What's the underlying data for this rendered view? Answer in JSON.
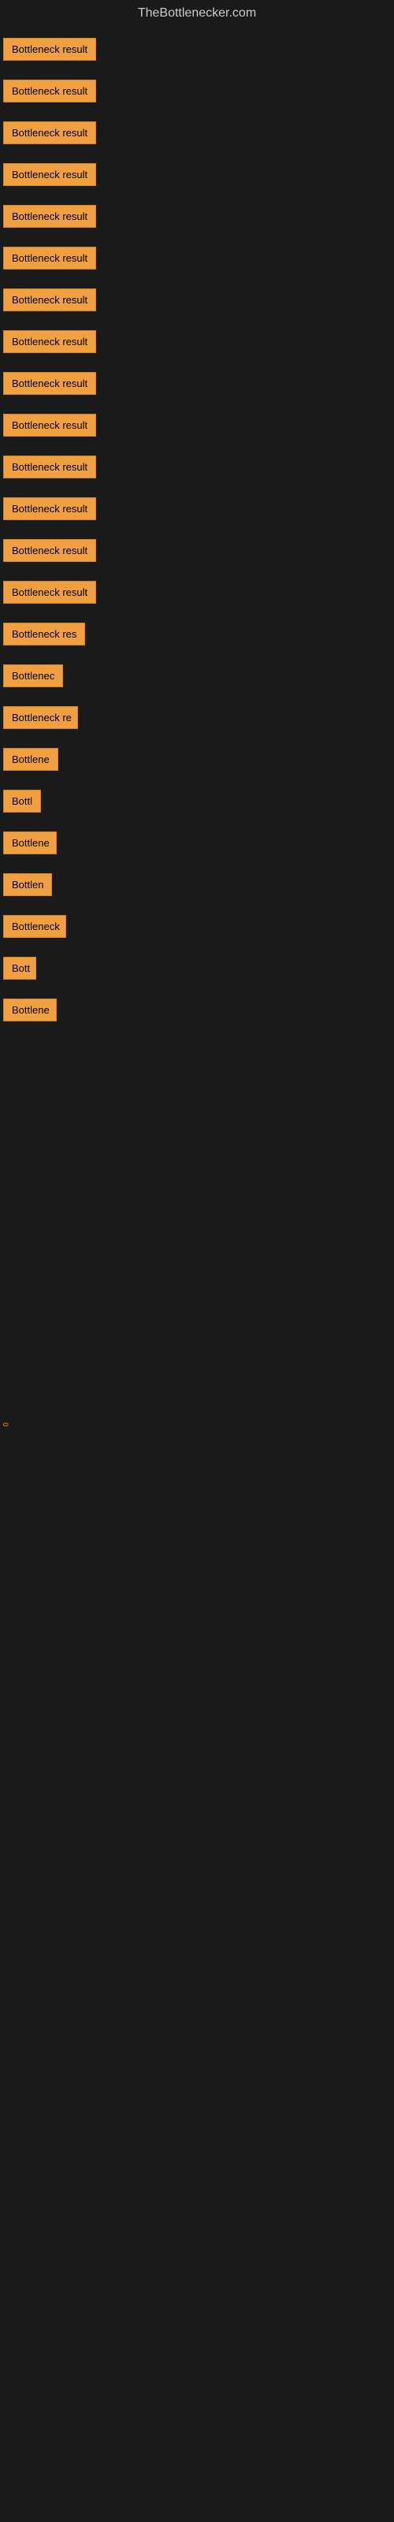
{
  "site": {
    "title": "TheBottlenecker.com"
  },
  "items": [
    {
      "label": "Bottleneck result",
      "width": 130
    },
    {
      "label": "Bottleneck result",
      "width": 130
    },
    {
      "label": "Bottleneck result",
      "width": 130
    },
    {
      "label": "Bottleneck result",
      "width": 130
    },
    {
      "label": "Bottleneck result",
      "width": 130
    },
    {
      "label": "Bottleneck result",
      "width": 130
    },
    {
      "label": "Bottleneck result",
      "width": 130
    },
    {
      "label": "Bottleneck result",
      "width": 130
    },
    {
      "label": "Bottleneck result",
      "width": 130
    },
    {
      "label": "Bottleneck result",
      "width": 130
    },
    {
      "label": "Bottleneck result",
      "width": 130
    },
    {
      "label": "Bottleneck result",
      "width": 130
    },
    {
      "label": "Bottleneck result",
      "width": 130
    },
    {
      "label": "Bottleneck result",
      "width": 130
    },
    {
      "label": "Bottleneck res",
      "width": 110
    },
    {
      "label": "Bottlenec",
      "width": 78
    },
    {
      "label": "Bottleneck re",
      "width": 95
    },
    {
      "label": "Bottlene",
      "width": 70
    },
    {
      "label": "Bottl",
      "width": 50
    },
    {
      "label": "Bottlene",
      "width": 68
    },
    {
      "label": "Bottlen",
      "width": 62
    },
    {
      "label": "Bottleneck",
      "width": 80
    },
    {
      "label": "Bott",
      "width": 42
    },
    {
      "label": "Bottlene",
      "width": 68
    }
  ],
  "small_label": "0"
}
